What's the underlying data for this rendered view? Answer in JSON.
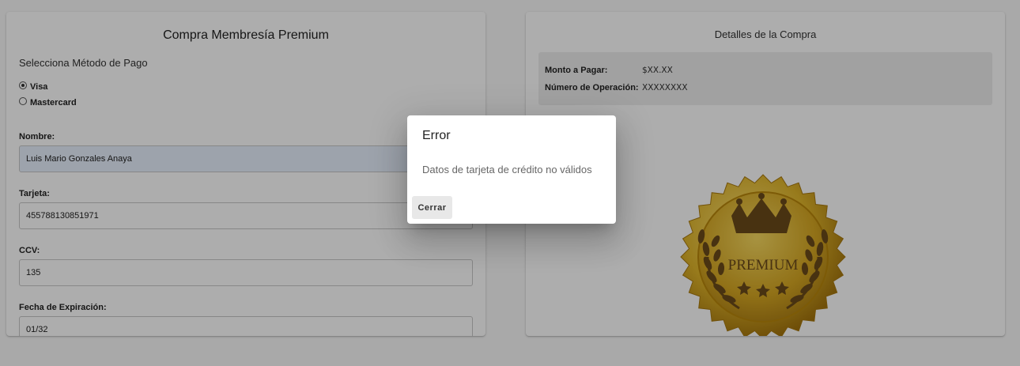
{
  "purchase_form": {
    "title": "Compra Membresía Premium",
    "payment_method_label": "Selecciona Método de Pago",
    "payment_methods": [
      {
        "label": "Visa",
        "selected": true
      },
      {
        "label": "Mastercard",
        "selected": false
      }
    ],
    "fields": {
      "name": {
        "label": "Nombre:",
        "value": "Luis Mario Gonzales Anaya"
      },
      "card": {
        "label": "Tarjeta:",
        "value": "455788130851971"
      },
      "ccv": {
        "label": "CCV:",
        "value": "135"
      },
      "expiry": {
        "label": "Fecha de Expiración:",
        "value": "01/32"
      }
    }
  },
  "purchase_details": {
    "title": "Detalles de la Compra",
    "rows": [
      {
        "key": "Monto a Pagar:",
        "value": "$XX.XX"
      },
      {
        "key": "Número de Operación:",
        "value": "XXXXXXXX"
      }
    ],
    "badge_text": "PREMIUM"
  },
  "dialog": {
    "title": "Error",
    "message": "Datos de tarjeta de crédito no válidos",
    "close_label": "Cerrar"
  },
  "colors": {
    "badge_gold": "#d4a017",
    "badge_dark": "#6b4a1a",
    "overlay": "#000000"
  }
}
